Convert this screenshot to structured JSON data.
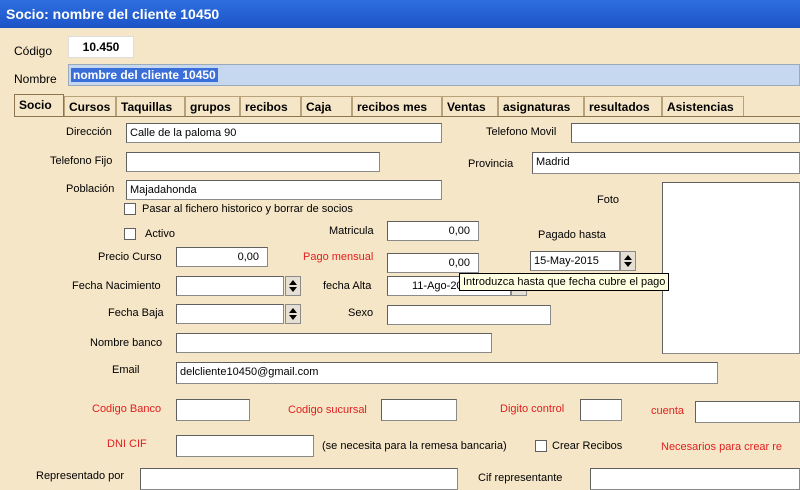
{
  "window": {
    "title": "Socio: nombre del cliente 10450"
  },
  "header": {
    "codigo_label": "Código",
    "codigo_value": "10.450",
    "nombre_label": "Nombre",
    "nombre_value": "nombre del cliente 10450"
  },
  "tabs": [
    {
      "label": "Socio"
    },
    {
      "label": "Cursos"
    },
    {
      "label": "Taquillas"
    },
    {
      "label": "grupos"
    },
    {
      "label": "recibos"
    },
    {
      "label": "Caja"
    },
    {
      "label": "recibos mes"
    },
    {
      "label": "Ventas"
    },
    {
      "label": "asignaturas"
    },
    {
      "label": "resultados"
    },
    {
      "label": "Asistencias"
    }
  ],
  "form": {
    "direccion_label": "Dirección",
    "direccion_value": "Calle de la paloma 90",
    "telefono_movil_label": "Telefono Movil",
    "telefono_fijo_label": "Telefono Fijo",
    "provincia_label": "Provincia",
    "provincia_value": "Madrid",
    "poblacion_label": "Población",
    "poblacion_value": "Majadahonda",
    "foto_label": "Foto",
    "historico_label": "Pasar al fichero historico y borrar de socios",
    "activo_label": "Activo",
    "matricula_label": "Matricula",
    "matricula_value": "0,00",
    "pagado_hasta_label": "Pagado hasta",
    "pagado_hasta_value": "15-May-2015",
    "precio_curso_label": "Precio Curso",
    "precio_curso_value": "0,00",
    "pago_mensual_label": "Pago mensual",
    "pago_mensual_value": "0,00",
    "fecha_nacimiento_label": "Fecha Nacimiento",
    "fecha_alta_label": "fecha Alta",
    "fecha_alta_value": "11-Ago-2015",
    "fecha_baja_label": "Fecha Baja",
    "sexo_label": "Sexo",
    "nombre_banco_label": "Nombre banco",
    "email_label": "Email",
    "email_value": "delcliente10450@gmail.com",
    "codigo_banco_label": "Codigo Banco",
    "codigo_sucursal_label": "Codigo sucursal",
    "digito_control_label": "Digito control",
    "cuenta_label": "cuenta",
    "dni_cif_label": "DNI CIF",
    "remesa_note": "(se necesita para la remesa bancaria)",
    "crear_recibos_label": "Crear Recibos",
    "necesarios_note": "Necesarios para crear re",
    "representado_label": "Representado por",
    "cif_representante_label": "Cif representante"
  },
  "tooltip": {
    "text": "Introduzca hasta que fecha cubre el pago"
  },
  "colors": {
    "titlebar": "#1c54c6",
    "background": "#f5e6c8",
    "required_label": "#e0201e",
    "selection": "#3a6ed8"
  }
}
